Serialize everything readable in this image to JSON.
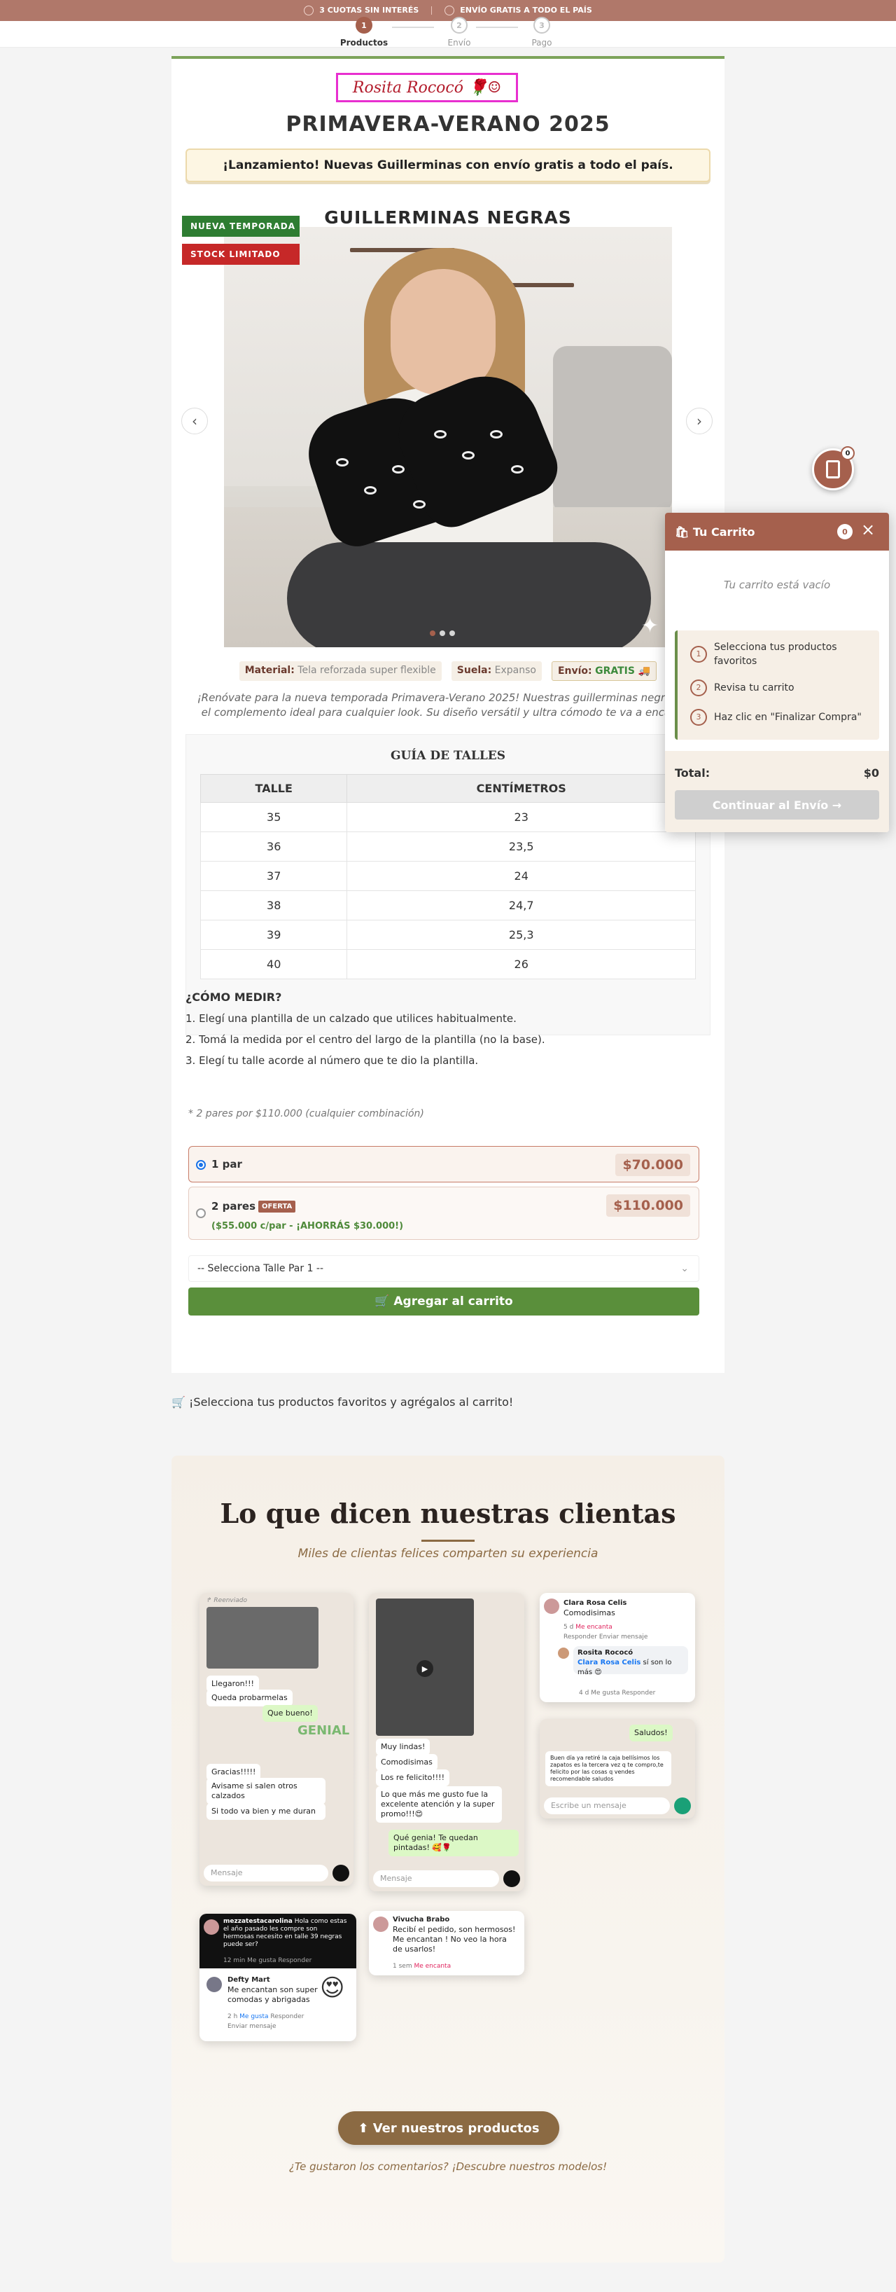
{
  "topbar": {
    "left": "3 CUOTAS SIN INTERÉS",
    "right": "ENVÍO GRATIS A TODO EL PAÍS"
  },
  "steps": [
    {
      "num": "1",
      "label": "Productos"
    },
    {
      "num": "2",
      "label": "Envío"
    },
    {
      "num": "3",
      "label": "Pago"
    }
  ],
  "brand": {
    "logo": "Rosita Rococó 🌹☺"
  },
  "season": "PRIMAVERA-VERANO 2025",
  "launch": "¡Lanzamiento! Nuevas Guillerminas con envío gratis a todo el país.",
  "product": {
    "title": "GUILLERMINAS NEGRAS",
    "badges": [
      "NUEVA TEMPORADA",
      "STOCK LIMITADO"
    ],
    "specs": {
      "material_label": "Material:",
      "material": "Tela reforzada super flexible",
      "sole_label": "Suela:",
      "sole": "Expanso",
      "ship_label": "Envío:",
      "ship": "GRATIS 🚚"
    },
    "description": "¡Renóvate para la nueva temporada Primavera-Verano 2025! Nuestras guillerminas negras son el complemento ideal para cualquier look. Su diseño versátil y ultra cómodo te va a encantar."
  },
  "size_guide": {
    "title": "GUÍA DE TALLES",
    "headers": [
      "TALLE",
      "CENTÍMETROS"
    ],
    "rows": [
      [
        "35",
        "23"
      ],
      [
        "36",
        "23,5"
      ],
      [
        "37",
        "24"
      ],
      [
        "38",
        "24,7"
      ],
      [
        "39",
        "25,3"
      ],
      [
        "40",
        "26"
      ]
    ],
    "how_title": "¿CÓMO MEDIR?",
    "how_steps": [
      "1. Elegí una plantilla de un calzado que utilices habitualmente.",
      "2. Tomá la medida por el centro del largo de la plantilla (no la base).",
      "3. Elegí tu talle acorde al número que te dio la plantilla."
    ]
  },
  "purchase": {
    "promo_note": "* 2 pares por $110.000 (cualquier combinación)",
    "options": [
      {
        "label": "1 par",
        "price": "$70.000",
        "selected": true
      },
      {
        "label": "2 pares",
        "badge": "OFERTA",
        "price": "$110.000",
        "savings": "($55.000 c/par - ¡AHORRÁS $30.000!)"
      }
    ],
    "size_select": "-- Selecciona Talle Par 1 --",
    "add_to_cart": "🛒 Agregar al carrito"
  },
  "hint": "🛒 ¡Selecciona tus productos favoritos y agrégalos al carrito!",
  "testimonials": {
    "title": "Lo que dicen nuestras clientas",
    "subtitle": "Miles de clientas felices comparten su experiencia",
    "chat1": {
      "forwarded": "↱ Reenviado",
      "m1": "Llegaron!!!",
      "m2": "Queda probarmelas",
      "m3": "Que bueno!",
      "genial": "GENIAL",
      "m4": "Gracias!!!!!",
      "m5": "Avisame si salen otros calzados",
      "m6": "Si todo va bien y me duran",
      "composer": "Mensaje"
    },
    "chat2": {
      "m1": "Muy lindas!",
      "m2": "Comodisimas",
      "m3": "Los re felicito!!!!",
      "m4": "Lo que más me gusto fue la excelente atención y la super promo!!!😍",
      "m5": "Qué genia! Te quedan pintadas! 🥰🌹",
      "composer": "Mensaje"
    },
    "comment1": {
      "name": "Clara Rosa Celis",
      "text": "Comodisimas",
      "time": "5 d",
      "love": "Me encanta",
      "reply": "Responder",
      "send": "Enviar mensaje",
      "reply_name": "Rosita Rococó",
      "reply_tag": "Clara Rosa Celis",
      "reply_text": "sí son lo más 😍",
      "reply_time": "4 d",
      "like": "Me gusta",
      "reply2": "Responder"
    },
    "chat3": {
      "hi": "Saludos!",
      "text": "Buen día ya retiré la caja bellísimos los zapatos es la tercera vez q te compro,te felicito por las cosas q vendes recomendable saludos",
      "composer": "Escribe un mensaje"
    },
    "comment2": {
      "name": "mezzatestacarolina",
      "text": "Hola como estas el año pasado les compre son hermosas necesito en talle 39 negras puede ser?",
      "time": "12 min",
      "like": "Me gusta",
      "reply": "Responder",
      "reply_name": "Defty Mart",
      "reply_text": "Me encantan son super comodas y abrigadas",
      "reply_time": "2 h",
      "like2": "Me gusta",
      "reply2": "Responder",
      "send": "Enviar mensaje"
    },
    "comment3": {
      "name": "Vivucha Brabo",
      "text": "Recibí el pedido, son hermosos! Me encantan ! No veo la hora de usarlos!",
      "time": "1 sem",
      "love": "Me encanta"
    },
    "cta": "⬆ Ver nuestros productos",
    "liked": "¿Te gustaron los comentarios? ¡Descubre nuestros modelos!"
  },
  "cart": {
    "float_count": "0",
    "title": "🛍 Tu Carrito",
    "count": "0",
    "empty": "Tu carrito está vacío",
    "steps": [
      "Selecciona tus productos favoritos",
      "Revisa tu carrito",
      "Haz clic en \"Finalizar Compra\""
    ],
    "total_label": "Total:",
    "total": "$0",
    "continue": "Continuar al Envío →"
  },
  "colors": {
    "accent": "#a5604d",
    "green": "#5a8f3b",
    "brown": "#8b6a43"
  }
}
